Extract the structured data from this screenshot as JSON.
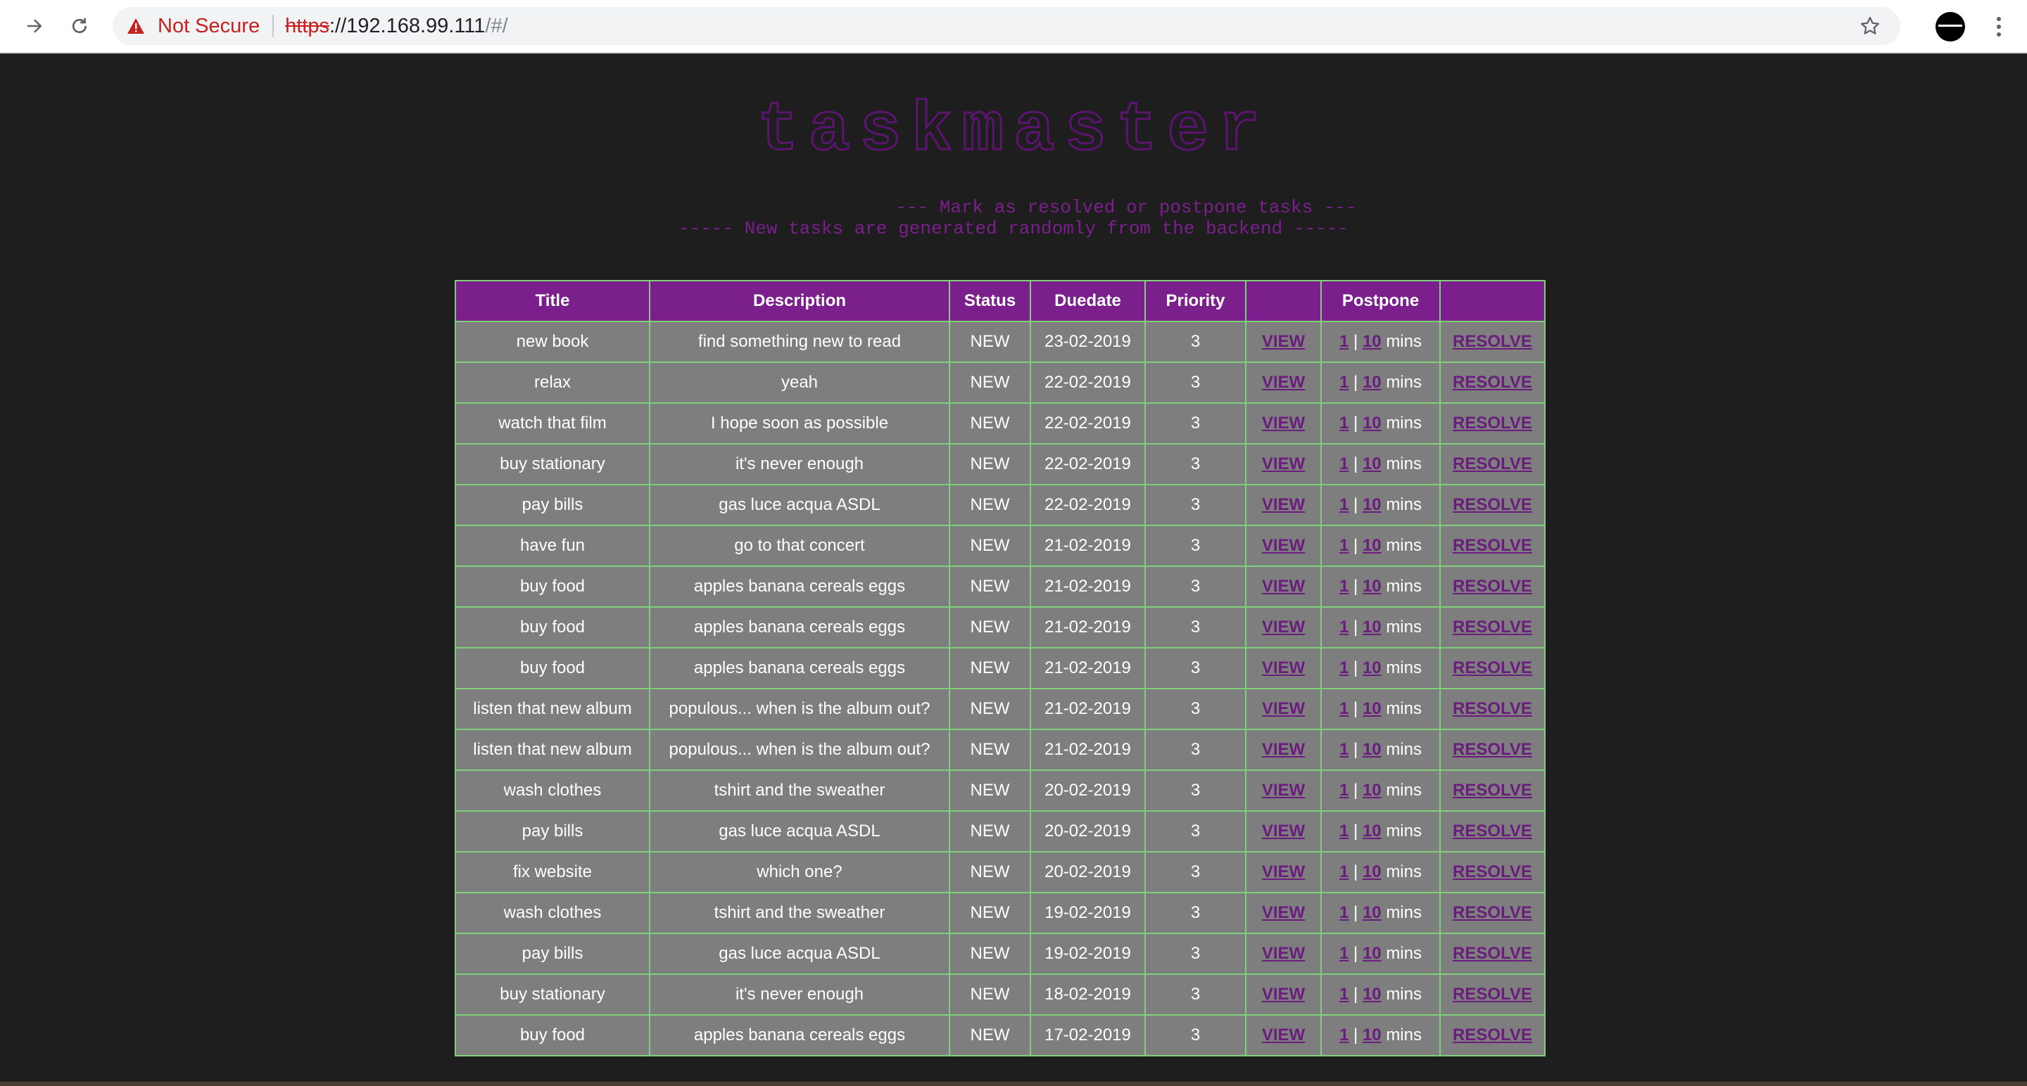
{
  "browser": {
    "security_label": "Not Secure",
    "url_scheme": "https",
    "url_host": "://192.168.99.111",
    "url_path": "/#/"
  },
  "header": {
    "logo_text": "taskmaster",
    "subtitle_line_1": "--- Mark as resolved or postpone tasks ---",
    "subtitle_line_2": "----- New tasks are generated randomly from the backend -----"
  },
  "table": {
    "headers": {
      "title": "Title",
      "description": "Description",
      "status": "Status",
      "duedate": "Duedate",
      "priority": "Priority",
      "view": "",
      "postpone": "Postpone",
      "resolve": ""
    },
    "row_labels": {
      "view": "VIEW",
      "postpone_1": "1",
      "separator": "|",
      "postpone_10": "10",
      "mins": "mins",
      "resolve": "RESOLVE"
    },
    "rows": [
      {
        "title": "new book",
        "description": "find something new to read",
        "status": "NEW",
        "duedate": "23-02-2019",
        "priority": "3"
      },
      {
        "title": "relax",
        "description": "yeah",
        "status": "NEW",
        "duedate": "22-02-2019",
        "priority": "3"
      },
      {
        "title": "watch that film",
        "description": "I hope soon as possible",
        "status": "NEW",
        "duedate": "22-02-2019",
        "priority": "3"
      },
      {
        "title": "buy stationary",
        "description": "it's never enough",
        "status": "NEW",
        "duedate": "22-02-2019",
        "priority": "3"
      },
      {
        "title": "pay bills",
        "description": "gas luce acqua ASDL",
        "status": "NEW",
        "duedate": "22-02-2019",
        "priority": "3"
      },
      {
        "title": "have fun",
        "description": "go to that concert",
        "status": "NEW",
        "duedate": "21-02-2019",
        "priority": "3"
      },
      {
        "title": "buy food",
        "description": "apples banana cereals eggs",
        "status": "NEW",
        "duedate": "21-02-2019",
        "priority": "3"
      },
      {
        "title": "buy food",
        "description": "apples banana cereals eggs",
        "status": "NEW",
        "duedate": "21-02-2019",
        "priority": "3"
      },
      {
        "title": "buy food",
        "description": "apples banana cereals eggs",
        "status": "NEW",
        "duedate": "21-02-2019",
        "priority": "3"
      },
      {
        "title": "listen that new album",
        "description": "populous... when is the album out?",
        "status": "NEW",
        "duedate": "21-02-2019",
        "priority": "3"
      },
      {
        "title": "listen that new album",
        "description": "populous... when is the album out?",
        "status": "NEW",
        "duedate": "21-02-2019",
        "priority": "3"
      },
      {
        "title": "wash clothes",
        "description": "tshirt and the sweather",
        "status": "NEW",
        "duedate": "20-02-2019",
        "priority": "3"
      },
      {
        "title": "pay bills",
        "description": "gas luce acqua ASDL",
        "status": "NEW",
        "duedate": "20-02-2019",
        "priority": "3"
      },
      {
        "title": "fix website",
        "description": "which one?",
        "status": "NEW",
        "duedate": "20-02-2019",
        "priority": "3"
      },
      {
        "title": "wash clothes",
        "description": "tshirt and the sweather",
        "status": "NEW",
        "duedate": "19-02-2019",
        "priority": "3"
      },
      {
        "title": "pay bills",
        "description": "gas luce acqua ASDL",
        "status": "NEW",
        "duedate": "19-02-2019",
        "priority": "3"
      },
      {
        "title": "buy stationary",
        "description": "it's never enough",
        "status": "NEW",
        "duedate": "18-02-2019",
        "priority": "3"
      },
      {
        "title": "buy food",
        "description": "apples banana cereals eggs",
        "status": "NEW",
        "duedate": "17-02-2019",
        "priority": "3"
      }
    ]
  },
  "colors": {
    "page_background": "#1e1e1e",
    "header_purple": "#7a1f8c",
    "cell_gray": "#7e7e7e",
    "border_green": "#7fd07a",
    "link_purple": "#6a1d7d",
    "warning_red": "#c5221f"
  },
  "icons": {
    "forward": "arrow-right-icon",
    "reload": "reload-icon",
    "warning": "warning-triangle-icon",
    "bookmark": "star-icon",
    "profile": "avatar",
    "menu": "more-vertical-icon"
  }
}
